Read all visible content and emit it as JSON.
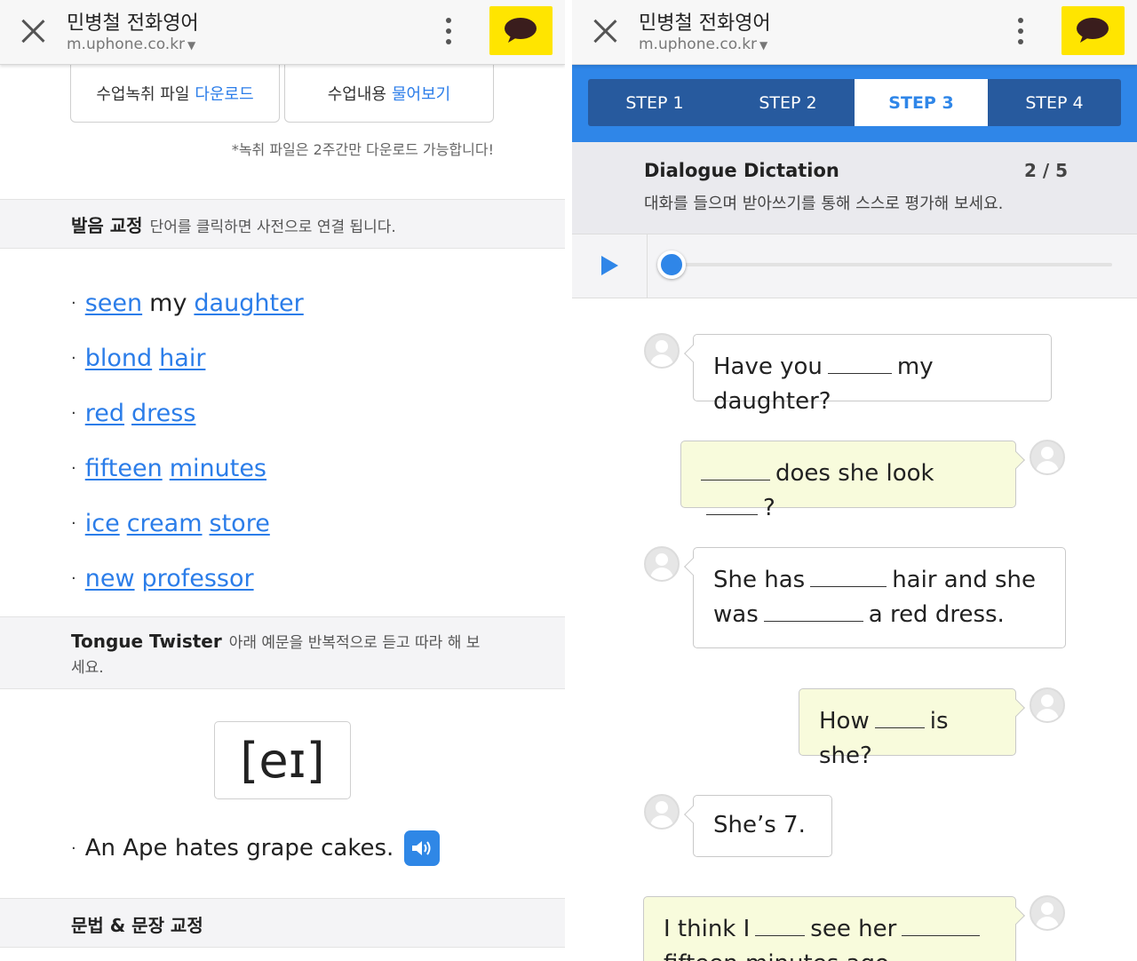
{
  "left": {
    "topbar": {
      "title": "민병철 전화영어",
      "url": "m.uphone.co.kr"
    },
    "download_button": {
      "label": "수업녹취 파일",
      "highlight": "다운로드"
    },
    "ask_button": {
      "label": "수업내용",
      "highlight": "물어보기"
    },
    "download_note": "*녹취 파일은 2주간만 다운로드 가능합니다!",
    "pronunciation": {
      "title": "발음 교정",
      "desc": "단어를 클릭하면 사전으로 연결 됩니다."
    },
    "words": [
      {
        "w1": "seen",
        "mid": "my",
        "w2": "daughter"
      },
      {
        "w1": "blond",
        "w2": "hair"
      },
      {
        "w1": "red",
        "w2": "dress"
      },
      {
        "w1": "fifteen",
        "w2": "minutes"
      },
      {
        "w1": "ice",
        "w2": "cream",
        "w3": "store"
      },
      {
        "w1": "new",
        "w2": "professor"
      }
    ],
    "tongue_twister": {
      "title": "Tongue Twister",
      "desc": "아래 예문을 반복적으로 듣고 따라 해 보세요."
    },
    "phoneme": "[eɪ]",
    "sentence": "An Ape hates grape cakes.",
    "grammar": {
      "title": "문법 & 문장 교정"
    },
    "bullet": "·"
  },
  "right": {
    "topbar": {
      "title": "민병철 전화영어",
      "url": "m.uphone.co.kr"
    },
    "steps": [
      "STEP 1",
      "STEP 2",
      "STEP 3",
      "STEP 4"
    ],
    "active_step": 3,
    "dictation": {
      "title": "Dialogue Dictation",
      "page": "2 / 5",
      "desc": "대화를 들으며 받아쓰기를 통해 스스로 평가해 보세요."
    },
    "player": {
      "progress": 0
    },
    "messages": [
      {
        "side": "left",
        "a": "Have you",
        "b": "my daughter?"
      },
      {
        "side": "right",
        "b": "does she look",
        "c": "?"
      },
      {
        "side": "left",
        "a": "She has",
        "b": "hair and she",
        "c": "was",
        "d": "a red dress."
      },
      {
        "side": "right",
        "a": "How",
        "b": "is she?"
      },
      {
        "side": "left",
        "a": "She’s 7."
      },
      {
        "side": "right",
        "a": "I think I",
        "b": "see her",
        "c": "fifteen minutes ago."
      }
    ]
  },
  "colors": {
    "link": "#2b7de9",
    "kakao": "#ffe500",
    "step_bar": "#2f86e8",
    "step_inner": "#275a9e",
    "reply_bubble": "#f8fbdc"
  }
}
